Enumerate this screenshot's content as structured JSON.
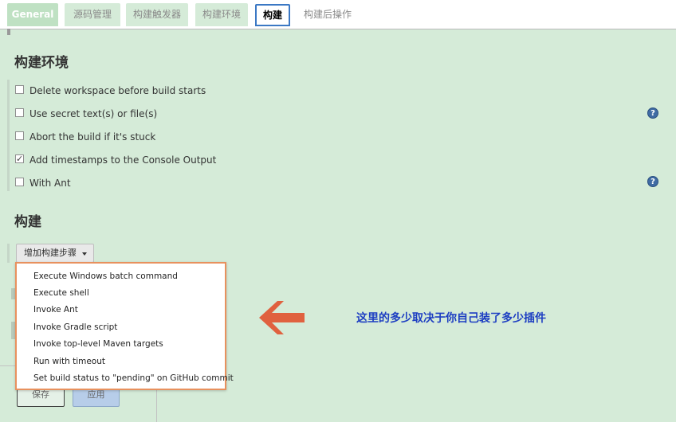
{
  "tabs": [
    {
      "label": "General"
    },
    {
      "label": "源码管理"
    },
    {
      "label": "构建触发器"
    },
    {
      "label": "构建环境"
    },
    {
      "label": "构建"
    },
    {
      "label": "构建后操作"
    }
  ],
  "build_env": {
    "title": "构建环境",
    "options": [
      {
        "label": "Delete workspace before build starts",
        "checked": false
      },
      {
        "label": "Use secret text(s) or file(s)",
        "checked": false
      },
      {
        "label": "Abort the build if it's stuck",
        "checked": false
      },
      {
        "label": "Add timestamps to the Console Output",
        "checked": true
      },
      {
        "label": "With Ant",
        "checked": false
      }
    ],
    "help_glyph": "?"
  },
  "build": {
    "title": "构建",
    "add_step_label": "增加构建步骤",
    "menu_items": [
      "Execute Windows batch command",
      "Execute shell",
      "Invoke Ant",
      "Invoke Gradle script",
      "Invoke top-level Maven targets",
      "Run with timeout",
      "Set build status to \"pending\" on GitHub commit"
    ]
  },
  "footer": {
    "save_label": "保存",
    "apply_label": "应用"
  },
  "annotation": {
    "text": "这里的多少取决于你自己装了多少插件",
    "arrow_color": "#e0613f",
    "text_color": "#1d3ec2"
  },
  "colors": {
    "background": "#d5ebd8",
    "active_tab_border": "#3b78c4",
    "menu_border": "#e8915e"
  }
}
